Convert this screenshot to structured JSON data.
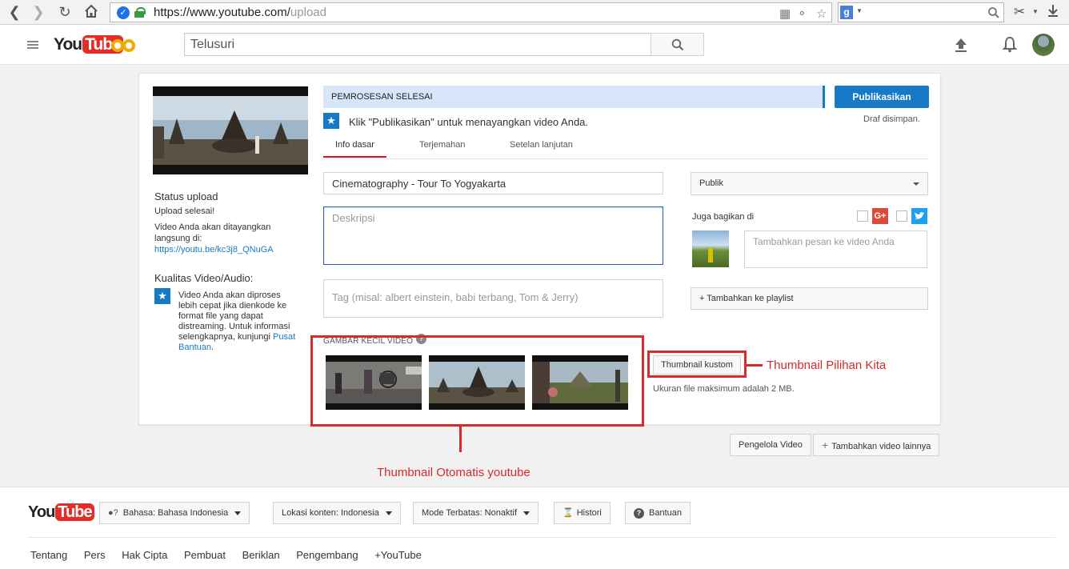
{
  "browser": {
    "url_host": "https://www.youtube.com/",
    "url_path": "upload"
  },
  "header": {
    "logo_you": "You",
    "logo_tube": "Tube",
    "search_placeholder": "Telusuri"
  },
  "upload": {
    "processing_status": "PEMROSESAN SELESAI",
    "publish_button": "Publikasikan",
    "draft_saved": "Draf disimpan.",
    "publish_hint": "Klik \"Publikasikan\" untuk menayangkan video Anda.",
    "tabs": [
      {
        "label": "Info dasar",
        "active": true
      },
      {
        "label": "Terjemahan",
        "active": false
      },
      {
        "label": "Setelan lanjutan",
        "active": false
      }
    ],
    "title_value": "Cinematography - Tour To Yogyakarta",
    "description_placeholder": "Deskripsi",
    "tags_placeholder": "Tag (misal: albert einstein, babi terbang, Tom & Jerry)",
    "privacy_value": "Publik",
    "share_label": "Juga bagikan di",
    "share_message_placeholder": "Tambahkan pesan ke video Anda",
    "add_playlist": "+ Tambahkan ke playlist",
    "thumbnails_label": "GAMBAR KECIL VIDEO",
    "custom_thumbnail_button": "Thumbnail kustom",
    "max_size_note": "Ukuran file maksimum adalah 2 MB."
  },
  "sidebar": {
    "status_heading": "Status upload",
    "status_text": "Upload selesai!",
    "live_text": "Video Anda akan ditayangkan langsung di:",
    "video_link": "https://youtu.be/kc3j8_QNuGA",
    "quality_heading": "Kualitas Video/Audio:",
    "quality_text": "Video Anda akan diproses lebih cepat jika dienkode ke format file yang dapat distreaming. Untuk informasi selengkapnya, kunjungi",
    "help_link": "Pusat Bantuan",
    "help_link_end": "."
  },
  "annotations": {
    "custom_label": "Thumbnail Pilihan Kita",
    "auto_label": "Thumbnail Otomatis youtube"
  },
  "below_card": {
    "video_manager": "Pengelola Video",
    "add_more_icon": "+",
    "add_more": "Tambahkan video lainnya"
  },
  "footer": {
    "logo_you": "You",
    "logo_tube": "Tube",
    "language": "Bahasa: Bahasa Indonesia",
    "location": "Lokasi konten: Indonesia",
    "restricted": "Mode Terbatas: Nonaktif",
    "history": "Histori",
    "help": "Bantuan",
    "links": [
      "Tentang",
      "Pers",
      "Hak Cipta",
      "Pembuat",
      "Beriklan",
      "Pengembang",
      "+YouTube"
    ]
  },
  "colors": {
    "youtube_red": "#e52d27",
    "annotation_red": "#d52b2b",
    "primary_blue": "#167ac6"
  }
}
